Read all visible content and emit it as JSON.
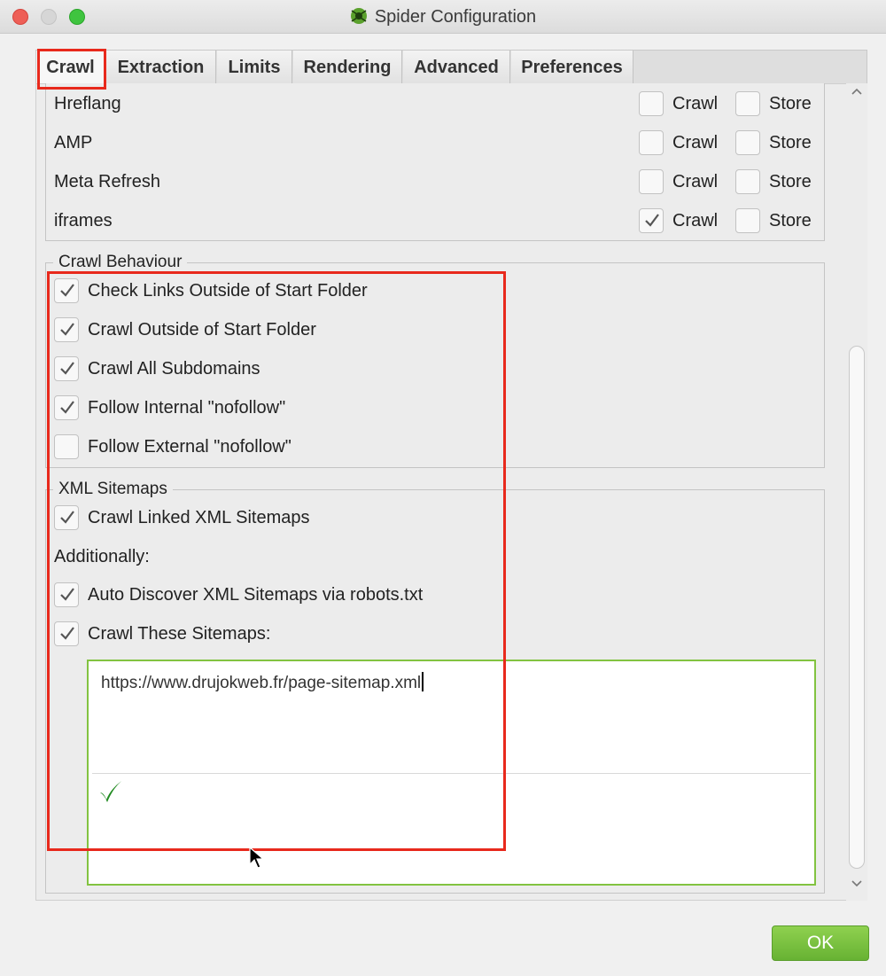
{
  "window": {
    "title": "Spider Configuration"
  },
  "tabs": [
    {
      "label": "Crawl",
      "active": true
    },
    {
      "label": "Extraction",
      "active": false
    },
    {
      "label": "Limits",
      "active": false
    },
    {
      "label": "Rendering",
      "active": false
    },
    {
      "label": "Advanced",
      "active": false
    },
    {
      "label": "Preferences",
      "active": false
    }
  ],
  "resource_rows": [
    {
      "label": "Hreflang",
      "crawl_label": "Crawl",
      "crawl_checked": false,
      "store_label": "Store",
      "store_checked": false
    },
    {
      "label": "AMP",
      "crawl_label": "Crawl",
      "crawl_checked": false,
      "store_label": "Store",
      "store_checked": false
    },
    {
      "label": "Meta Refresh",
      "crawl_label": "Crawl",
      "crawl_checked": false,
      "store_label": "Store",
      "store_checked": false
    },
    {
      "label": "iframes",
      "crawl_label": "Crawl",
      "crawl_checked": true,
      "store_label": "Store",
      "store_checked": false
    }
  ],
  "crawl_behaviour": {
    "title": "Crawl Behaviour",
    "options": [
      {
        "label": "Check Links Outside of Start Folder",
        "checked": true
      },
      {
        "label": "Crawl Outside of Start Folder",
        "checked": true
      },
      {
        "label": "Crawl All Subdomains",
        "checked": true
      },
      {
        "label": "Follow Internal \"nofollow\"",
        "checked": true
      },
      {
        "label": "Follow External \"nofollow\"",
        "checked": false
      }
    ]
  },
  "xml_sitemaps": {
    "title": "XML Sitemaps",
    "crawl_linked": {
      "label": "Crawl Linked XML Sitemaps",
      "checked": true
    },
    "additionally_label": "Additionally:",
    "auto_discover": {
      "label": "Auto Discover XML Sitemaps via robots.txt",
      "checked": true
    },
    "crawl_these": {
      "label": "Crawl These Sitemaps:",
      "checked": true
    },
    "sitemap_urls": "https://www.drujokweb.fr/page-sitemap.xml"
  },
  "footer": {
    "ok_label": "OK"
  },
  "colors": {
    "accent_green": "#82c341",
    "highlight_red": "#e8291c",
    "check_green": "#1f8a1f"
  }
}
